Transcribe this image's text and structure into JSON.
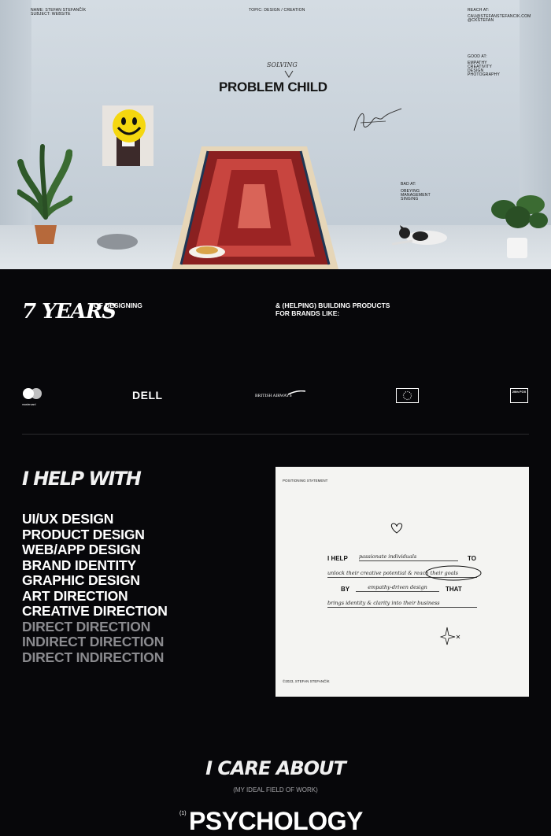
{
  "hero": {
    "name_line": "NAME: STEFAN STEFANČÍK",
    "subject_line": "SUBJECT: WEBSITE",
    "topic_line": "TOPIC: DESIGN / CREATION",
    "reach_label": "REACH AT:",
    "reach_email": "CAU@STEFANSTEFANCIK.COM",
    "reach_handle": "@CKSTEFAN",
    "good_label": "GOOD AT:",
    "good_items": [
      "EMPATHY",
      "CREATIVITY",
      "DESIGN",
      "PHOTOGRAPHY"
    ],
    "bad_label": "BAD AT:",
    "bad_items": [
      "OBEYING",
      "MANAGEMENT",
      "SINGING"
    ],
    "title": "PROBLEM CHILD",
    "title_annotation": "SOLVING"
  },
  "brands": {
    "years_text": "7 YEARS",
    "of_designing": "OF DESIGNING",
    "building_line1": "& (HELPING) BUILDING PRODUCTS",
    "building_line2": "FOR BRANDS LIKE:",
    "logos": [
      {
        "name": "mastercard",
        "text": "mastercard"
      },
      {
        "name": "dell",
        "text": "DELL"
      },
      {
        "name": "british-airways",
        "text": "BRITISH AIRWAYS"
      },
      {
        "name": "eu",
        "text": ""
      },
      {
        "name": "fox",
        "text": "20th FOX"
      }
    ]
  },
  "help": {
    "title": "I HELP WITH",
    "services": [
      {
        "label": "UI/UX DESIGN",
        "dim": false
      },
      {
        "label": "PRODUCT DESIGN",
        "dim": false
      },
      {
        "label": "WEB/APP DESIGN",
        "dim": false
      },
      {
        "label": "BRAND IDENTITY",
        "dim": false
      },
      {
        "label": "GRAPHIC DESIGN",
        "dim": false
      },
      {
        "label": "ART DIRECTION",
        "dim": false
      },
      {
        "label": "CREATIVE DIRECTION",
        "dim": false
      },
      {
        "label": "DIRECT DIRECTION",
        "dim": true
      },
      {
        "label": "INDIRECT DIRECTION",
        "dim": true
      },
      {
        "label": "DIRECT INDIRECTION",
        "dim": true
      }
    ]
  },
  "positioning": {
    "label": "POSITIONING STATEMENT",
    "i_help": "I HELP",
    "line1_script": "passionate individuals",
    "to": "TO",
    "line2_script": "unlock their creative potential & reach their goals",
    "by": "BY",
    "line3_script": "empathy-driven design",
    "that": "THAT",
    "line4_script": "brings identity & clarity into their business",
    "footer": "©2023, STEFAN STEFANČÍK"
  },
  "care": {
    "title": "I CARE ABOUT",
    "subtitle": "(MY IDEAL FIELD OF WORK)",
    "item_number": "(1)",
    "item_label": "PSYCHOLOGY"
  }
}
